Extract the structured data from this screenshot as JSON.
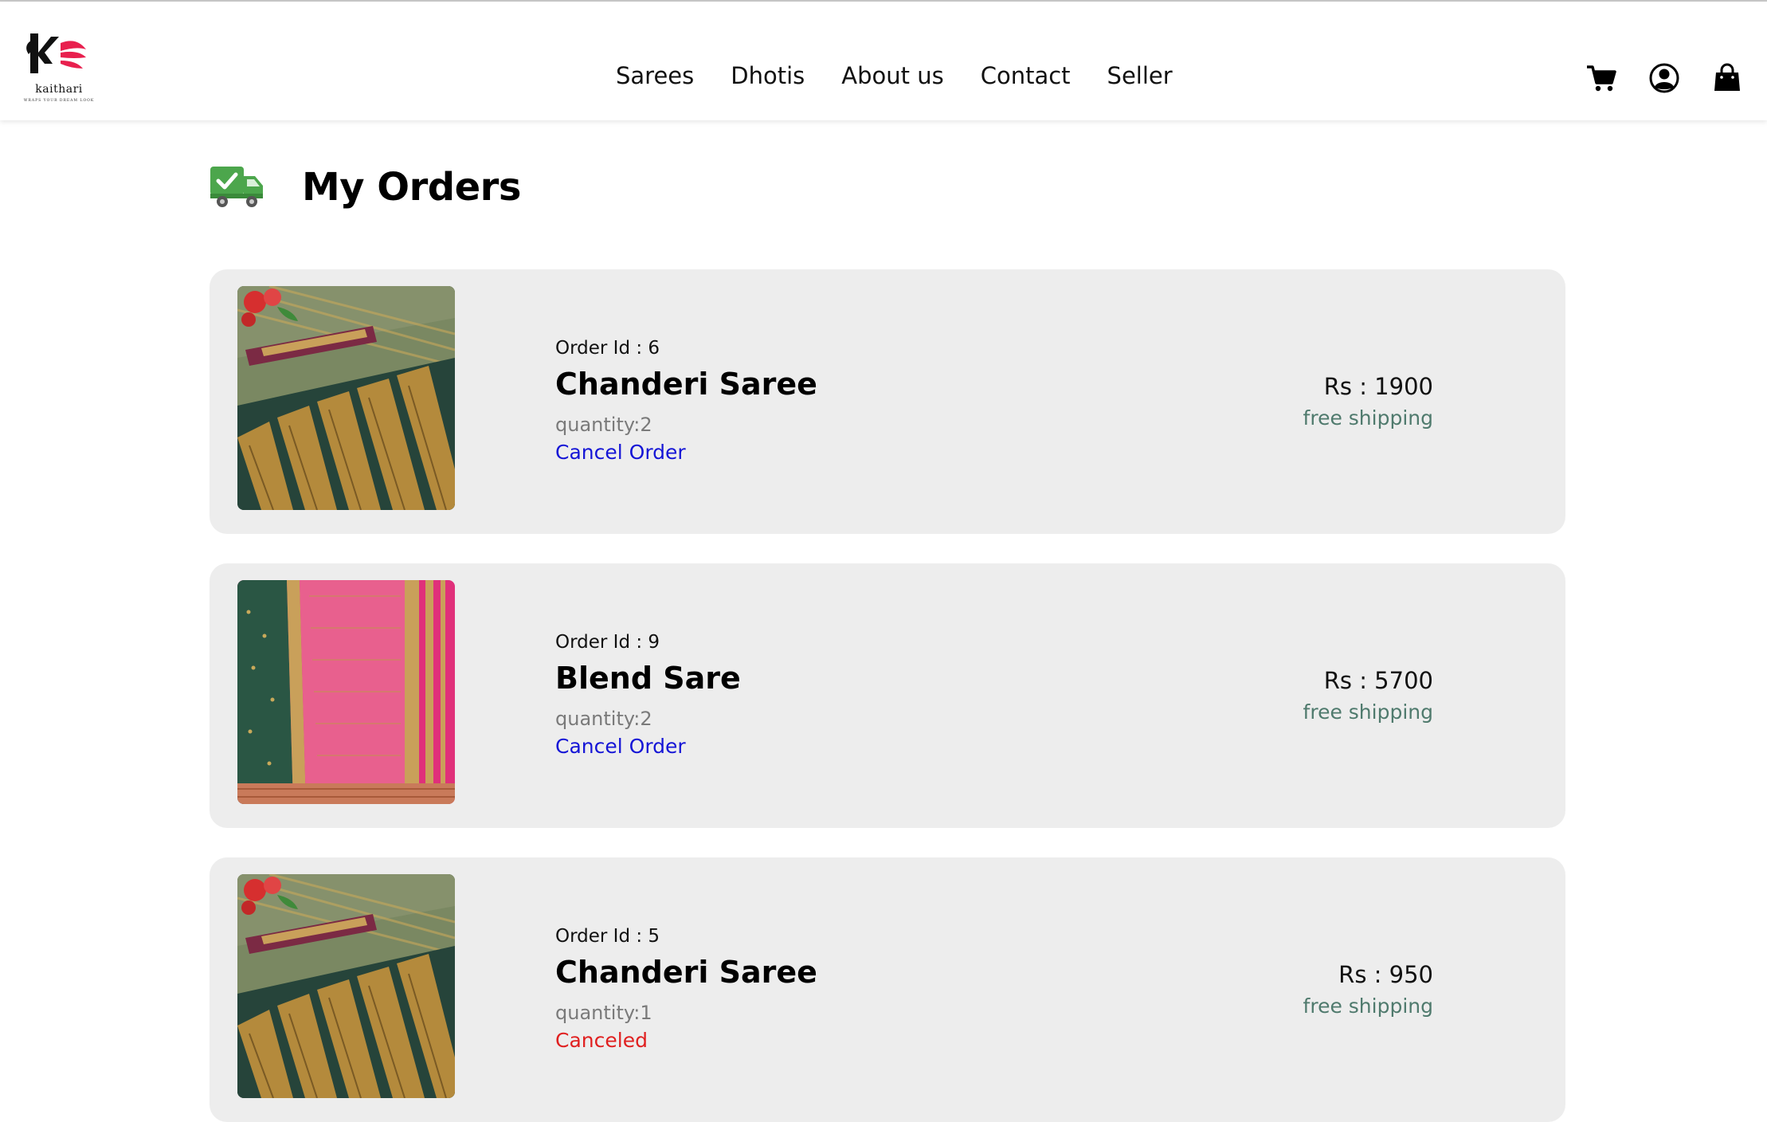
{
  "brand": {
    "name": "kaithari",
    "tagline": "WRAPS YOUR DREAM LOOK"
  },
  "nav": {
    "items": [
      {
        "label": "Sarees"
      },
      {
        "label": "Dhotis"
      },
      {
        "label": "About us"
      },
      {
        "label": "Contact"
      },
      {
        "label": "Seller"
      }
    ]
  },
  "header_icons": [
    "cart-icon",
    "user-account-icon",
    "shopping-bag-icon"
  ],
  "page": {
    "title": "My Orders",
    "title_icon": "delivery-truck-check-icon"
  },
  "orders": [
    {
      "order_id": "Order Id : 6",
      "name": "Chanderi Saree",
      "quantity": "quantity:2",
      "action": "Cancel Order",
      "status": "active",
      "price": "Rs : 1900",
      "shipping": "free shipping",
      "image": "green-gold-saree-with-roses"
    },
    {
      "order_id": "Order Id : 9",
      "name": "Blend Sare",
      "quantity": "quantity:2",
      "action": "Cancel Order",
      "status": "active",
      "price": "Rs : 5700",
      "shipping": "free shipping",
      "image": "green-pink-saree"
    },
    {
      "order_id": "Order Id : 5",
      "name": "Chanderi Saree",
      "quantity": "quantity:1",
      "action": "Canceled",
      "status": "canceled",
      "price": "Rs : 950",
      "shipping": "free shipping",
      "image": "green-gold-saree-with-roses"
    }
  ],
  "colors": {
    "card_bg": "#ededed",
    "cancel_link": "#1515d6",
    "canceled_text": "#e02020",
    "shipping_text": "#4f7a6d",
    "quantity_text": "#7a7a7a",
    "logo_accent": "#e8204e",
    "truck_green": "#4ca64c"
  }
}
